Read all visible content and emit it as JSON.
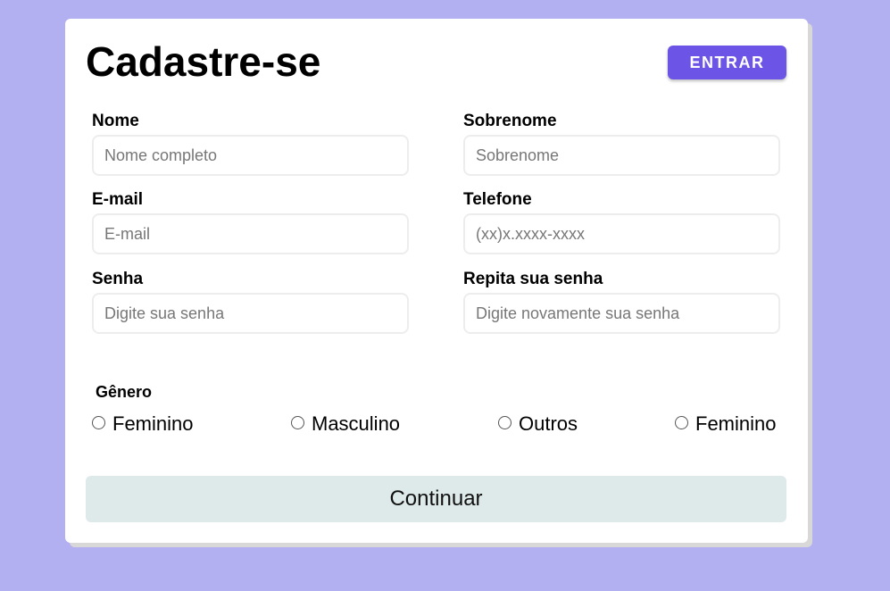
{
  "form": {
    "title": "Cadastre-se",
    "login_label": "ENTRAR",
    "fields": [
      {
        "label": "Nome",
        "placeholder": "Nome completo"
      },
      {
        "label": "Sobrenome",
        "placeholder": "Sobrenome"
      },
      {
        "label": "E-mail",
        "placeholder": "E-mail"
      },
      {
        "label": "Telefone",
        "placeholder": "(xx)x.xxxx-xxxx"
      },
      {
        "label": "Senha",
        "placeholder": "Digite sua senha"
      },
      {
        "label": "Repita sua senha",
        "placeholder": "Digite novamente sua senha"
      }
    ],
    "gender": {
      "title": "Gênero",
      "options": [
        "Feminino",
        "Masculino",
        "Outros",
        "Feminino"
      ]
    },
    "continue_label": "Continuar"
  },
  "colors": {
    "background": "#b3b0f1",
    "accent": "#6c54e6",
    "continue_button": "#dee9e9"
  }
}
